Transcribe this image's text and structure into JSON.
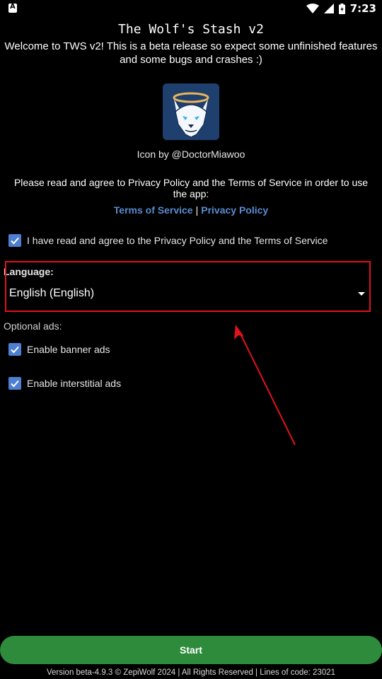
{
  "status_bar": {
    "time": "7:23"
  },
  "app": {
    "title": "The Wolf's Stash v2",
    "welcome": "Welcome to TWS v2! This is a beta release so expect some unfinished features and some bugs and crashes :)",
    "icon_credit": "Icon by @DoctorMiawoo"
  },
  "agreement": {
    "text": "Please read and agree to Privacy Policy and the Terms of Service in order to use the app:",
    "terms_link": "Terms of Service",
    "separator": "|",
    "privacy_link": "Privacy Policy",
    "checkbox_label": "I have read and agree to the Privacy Policy and the Terms of Service",
    "checked": true
  },
  "language": {
    "label": "Language:",
    "selected": "English (English)"
  },
  "ads": {
    "heading": "Optional ads:",
    "banner_label": "Enable banner ads",
    "banner_checked": true,
    "interstitial_label": "Enable interstitial ads",
    "interstitial_checked": true
  },
  "start_button": "Start",
  "footer": "Version beta-4.9.3 © ZepiWolf 2024 | All Rights Reserved | Lines of code: 23021",
  "colors": {
    "accent": "#4f7fd1",
    "link": "#5b8bd0",
    "start_green": "#2e8b3c",
    "annotation_red": "#e0131b"
  }
}
